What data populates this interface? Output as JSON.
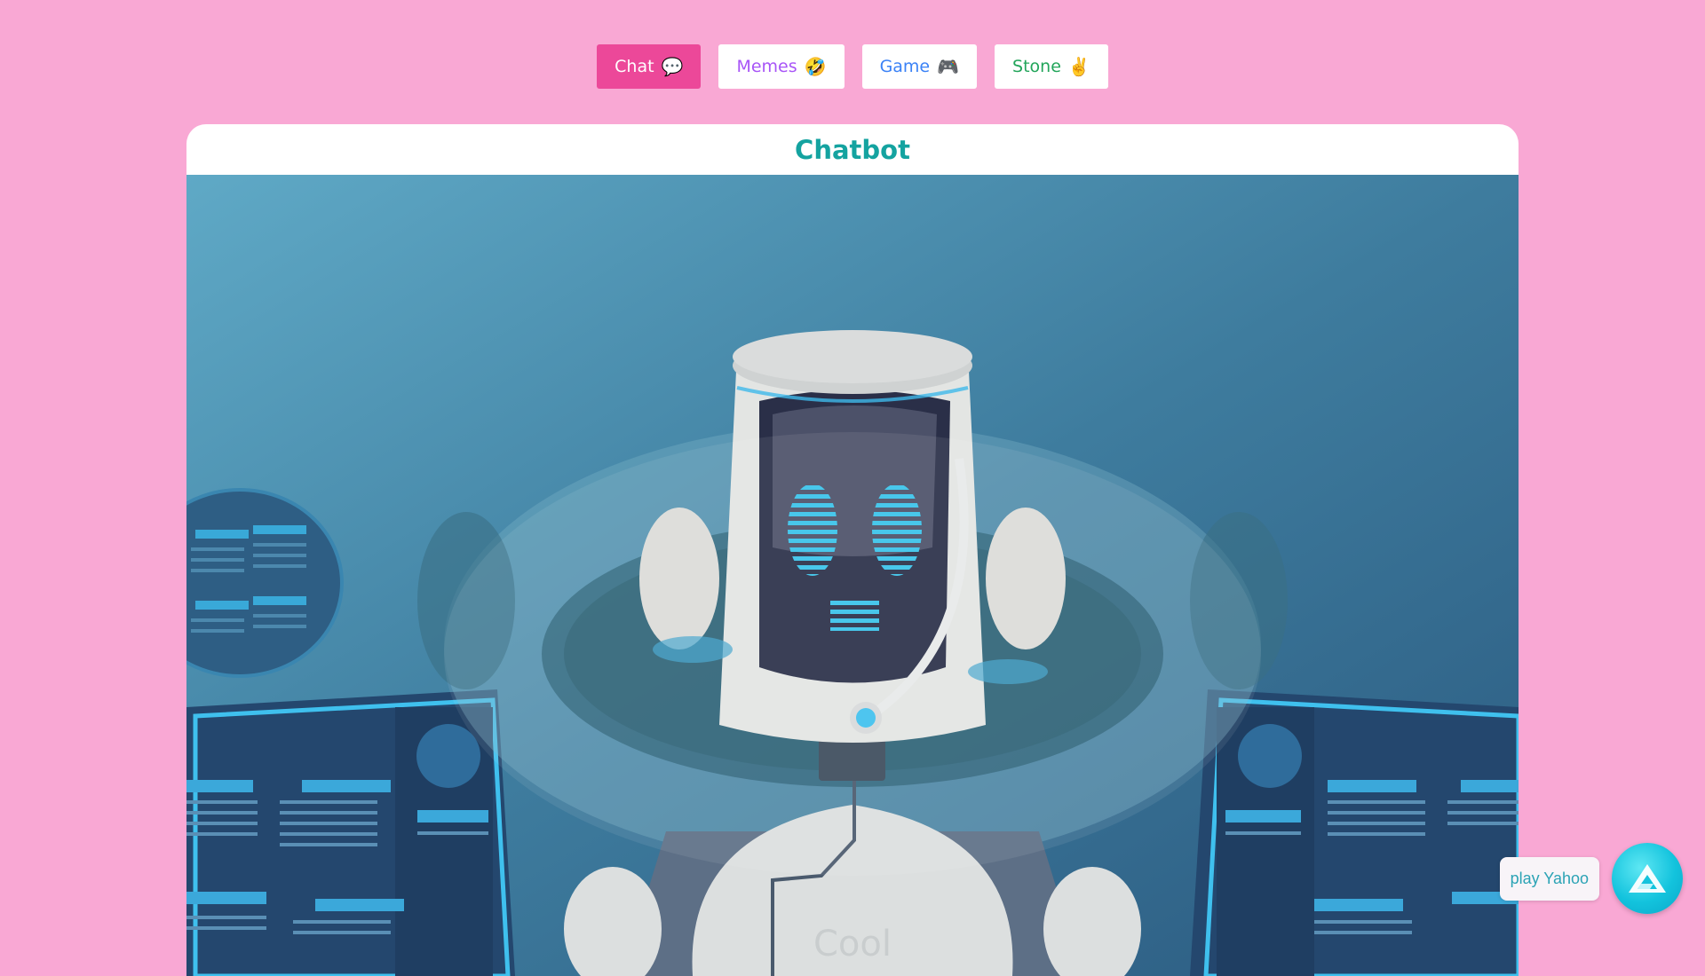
{
  "nav": {
    "items": [
      {
        "label": "Chat",
        "emoji": "💬",
        "color": "#ffffff",
        "active": true
      },
      {
        "label": "Memes",
        "emoji": "🤣",
        "color": "#a855f7",
        "active": false
      },
      {
        "label": "Game",
        "emoji": "🎮",
        "color": "#3b82f6",
        "active": false
      },
      {
        "label": "Stone",
        "emoji": "✌️",
        "color": "#22a55a",
        "active": false
      }
    ]
  },
  "card": {
    "title": "Chatbot",
    "robot_chest_text": "Cool"
  },
  "assistant": {
    "label": "play Yahoo",
    "icon": "triangle-logo-icon"
  },
  "colors": {
    "page_bg": "#f9a8d4",
    "accent": "#ec4899",
    "title": "#14a3a0"
  }
}
